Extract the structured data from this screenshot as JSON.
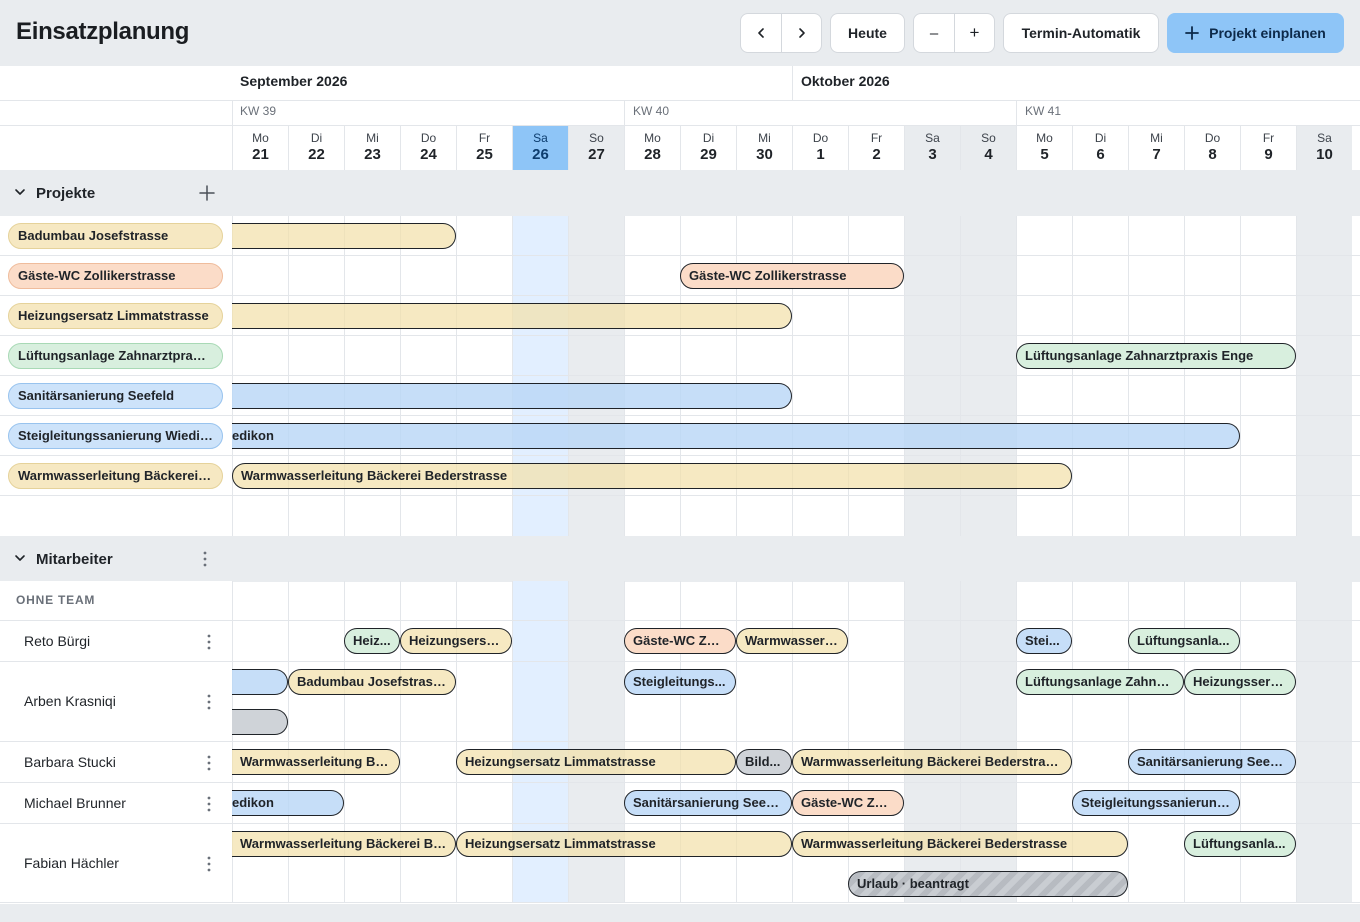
{
  "header": {
    "title": "Einsatzplanung",
    "today_label": "Heute",
    "auto_label": "Termin-Automatik",
    "primary_label": "Projekt einplanen",
    "zoom_out_symbol": "–",
    "zoom_in_symbol": "+"
  },
  "calendar": {
    "months": [
      "September 2026",
      "Oktober 2026"
    ],
    "weeks": [
      "KW 39",
      "KW 40",
      "KW 41"
    ],
    "days": [
      {
        "n": "Mo",
        "d": "21"
      },
      {
        "n": "Di",
        "d": "22"
      },
      {
        "n": "Mi",
        "d": "23"
      },
      {
        "n": "Do",
        "d": "24"
      },
      {
        "n": "Fr",
        "d": "25"
      },
      {
        "n": "Sa",
        "d": "26"
      },
      {
        "n": "So",
        "d": "27"
      },
      {
        "n": "Mo",
        "d": "28"
      },
      {
        "n": "Di",
        "d": "29"
      },
      {
        "n": "Mi",
        "d": "30"
      },
      {
        "n": "Do",
        "d": "1"
      },
      {
        "n": "Fr",
        "d": "2"
      },
      {
        "n": "Sa",
        "d": "3"
      },
      {
        "n": "So",
        "d": "4"
      },
      {
        "n": "Mo",
        "d": "5"
      },
      {
        "n": "Di",
        "d": "6"
      },
      {
        "n": "Mi",
        "d": "7"
      },
      {
        "n": "Do",
        "d": "8"
      },
      {
        "n": "Fr",
        "d": "9"
      },
      {
        "n": "Sa",
        "d": "10"
      }
    ],
    "today_index": 5
  },
  "projects_section": {
    "title": "Projekte",
    "items": [
      {
        "label": "Badumbau Josefstrasse",
        "color": "yellow"
      },
      {
        "label": "Gäste-WC Zollikerstrasse",
        "color": "orange"
      },
      {
        "label": "Heizungsersatz Limmatstrasse",
        "color": "yellow"
      },
      {
        "label": "Lüftungsanlage Zahnarztpraxis...",
        "color": "green"
      },
      {
        "label": "Sanitärsanierung Seefeld",
        "color": "blue"
      },
      {
        "label": "Steigleitungssanierung Wiedikon",
        "color": "blue"
      },
      {
        "label": "Warmwasserleitung Bäckerei B...",
        "color": "yellow"
      }
    ],
    "bars": [
      {
        "row": 0,
        "label": "",
        "color": "yellow"
      },
      {
        "row": 1,
        "label": "Gäste-WC Zollikerstrasse",
        "color": "orange"
      },
      {
        "row": 2,
        "label": "",
        "color": "yellow"
      },
      {
        "row": 3,
        "label": "Lüftungsanlage Zahnarztpraxis Enge",
        "color": "green"
      },
      {
        "row": 4,
        "label": "",
        "color": "blue"
      },
      {
        "row": 5,
        "label": "edikon",
        "color": "blue"
      },
      {
        "row": 6,
        "label": "Warmwasserleitung Bäckerei Bederstrasse",
        "color": "yellow"
      }
    ]
  },
  "employees_section": {
    "title": "Mitarbeiter",
    "team_label": "OHNE TEAM",
    "employees": [
      {
        "name": "Reto Bürgi"
      },
      {
        "name": "Arben Krasniqi"
      },
      {
        "name": "Barbara Stucki"
      },
      {
        "name": "Michael Brunner"
      },
      {
        "name": "Fabian Hächler"
      }
    ],
    "bars": [
      {
        "emp": 0,
        "lane": 0,
        "label": "Heiz...",
        "color": "green"
      },
      {
        "emp": 0,
        "lane": 0,
        "label": "Heizungsersa...",
        "color": "yellow"
      },
      {
        "emp": 0,
        "lane": 0,
        "label": "Gäste-WC Zol...",
        "color": "orange"
      },
      {
        "emp": 0,
        "lane": 0,
        "label": "Warmwasserl...",
        "color": "yellow"
      },
      {
        "emp": 0,
        "lane": 0,
        "label": "Stei...",
        "color": "blue"
      },
      {
        "emp": 0,
        "lane": 0,
        "label": "Lüftungsanla...",
        "color": "green"
      },
      {
        "emp": 1,
        "lane": 0,
        "label": "",
        "color": "blue"
      },
      {
        "emp": 1,
        "lane": 0,
        "label": "Badumbau Josefstrasse",
        "color": "yellow"
      },
      {
        "emp": 1,
        "lane": 0,
        "label": "Steigleitungs...",
        "color": "blue"
      },
      {
        "emp": 1,
        "lane": 0,
        "label": "Lüftungsanlage Zahnar...",
        "color": "green"
      },
      {
        "emp": 1,
        "lane": 0,
        "label": "Heizungsserv...",
        "color": "green"
      },
      {
        "emp": 1,
        "lane": 1,
        "label": "",
        "color": "gray"
      },
      {
        "emp": 2,
        "lane": 0,
        "label": "Warmwasserleitung Bä...",
        "color": "yellow"
      },
      {
        "emp": 2,
        "lane": 0,
        "label": "Heizungsersatz Limmatstrasse",
        "color": "yellow"
      },
      {
        "emp": 2,
        "lane": 0,
        "label": "Bild...",
        "color": "gray"
      },
      {
        "emp": 2,
        "lane": 0,
        "label": "Warmwasserleitung Bäckerei Bederstrasse",
        "color": "yellow"
      },
      {
        "emp": 2,
        "lane": 0,
        "label": "Sanitärsanierung Seefeld",
        "color": "blue"
      },
      {
        "emp": 3,
        "lane": 0,
        "label": "edikon",
        "color": "blue"
      },
      {
        "emp": 3,
        "lane": 0,
        "label": "Sanitärsanierung Seefeld",
        "color": "blue"
      },
      {
        "emp": 3,
        "lane": 0,
        "label": "Gäste-WC Zol...",
        "color": "orange"
      },
      {
        "emp": 3,
        "lane": 0,
        "label": "Steigleitungssanierung...",
        "color": "blue"
      },
      {
        "emp": 4,
        "lane": 0,
        "label": "Warmwasserleitung Bäckerei Be...",
        "color": "yellow"
      },
      {
        "emp": 4,
        "lane": 0,
        "label": "Heizungsersatz Limmatstrasse",
        "color": "yellow"
      },
      {
        "emp": 4,
        "lane": 0,
        "label": "Warmwasserleitung Bäckerei Bederstrasse",
        "color": "yellow"
      },
      {
        "emp": 4,
        "lane": 0,
        "label": "Lüftungsanla...",
        "color": "green"
      },
      {
        "emp": 4,
        "lane": 1,
        "label": "Urlaub · beantragt",
        "color": "hatch"
      }
    ]
  },
  "colors": {
    "accent": "#8ec5f7",
    "today_column": "#e2efff",
    "weekend": "#e9ecef"
  }
}
